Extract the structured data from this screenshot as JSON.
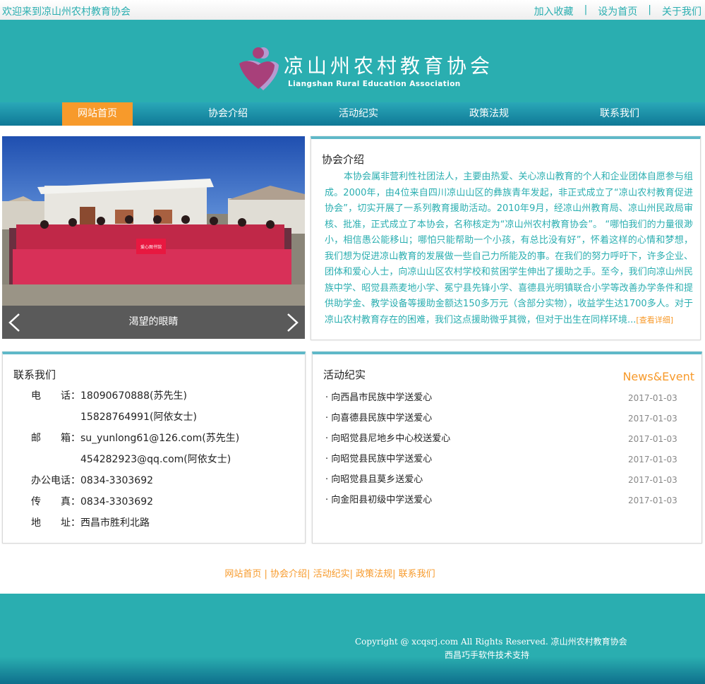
{
  "topbar": {
    "welcome": "欢迎来到凉山州农村教育协会",
    "links": [
      "加入收藏",
      "设为首页",
      "关于我们"
    ],
    "separator": "|"
  },
  "header": {
    "title_cn": "凉山州农村教育协会",
    "title_en": "Liangshan Rural Education Association"
  },
  "nav": {
    "items": [
      "网站首页",
      "协会介绍",
      "活动纪实",
      "政策法规",
      "联系我们"
    ],
    "active_index": 0
  },
  "slider": {
    "caption": "渴望的眼睛",
    "banner_text": "爱心图书馆"
  },
  "about": {
    "title": "协会介绍",
    "text": "本协会属非营利性社团法人，主要由热爱、关心凉山教育的个人和企业团体自愿参与组成。2000年，由4位来自四川凉山山区的彝族青年发起，非正式成立了“凉山农村教育促进协会”，切实开展了一系列教育援助活动。2010年9月，经凉山州教育局、凉山州民政局审核、批准，正式成立了本协会，名称核定为“凉山州农村教育协会”。 “哪怕我们的力量很渺小，相信愚公能移山；哪怕只能帮助一个小孩，有总比没有好”，怀着这样的心情和梦想，我们想为促进凉山教育的发展做一些自己力所能及的事。在我们的努力呼吁下，许多企业、团体和爱心人士，向凉山山区农村学校和贫困学生伸出了援助之手。至今，我们向凉山州民族中学、昭觉县燕麦地小学、冕宁县先锋小学、喜德县光明镇联合小学等改善办学条件和提供助学金、教学设备等援助金额达150多万元（含部分实物），收益学生达1700多人。对于凉山农村教育存在的困难，我们这点援助微乎其微，但对于出生在同样环境...",
    "more": "[查看详细]"
  },
  "contact": {
    "title": "联系我们",
    "rows": [
      {
        "label": "电　　话：",
        "value": "18090670888(苏先生)"
      },
      {
        "label": "",
        "value": "15828764991(阿依女士)"
      },
      {
        "label": "邮　　箱：",
        "value": "su_yunlong61@126.com(苏先生)"
      },
      {
        "label": "",
        "value": "454282923@qq.com(阿依女士)"
      },
      {
        "label": "办公电话：",
        "value": "0834-3303692"
      },
      {
        "label": "传　　真：",
        "value": "0834-3303692"
      },
      {
        "label": "地　　址：",
        "value": "西昌市胜利北路"
      }
    ]
  },
  "events": {
    "title": "活动纪实",
    "title_en": "News&Event",
    "items": [
      {
        "title": "· 向西昌市民族中学送爱心",
        "date": "2017-01-03"
      },
      {
        "title": "· 向喜德县民族中学送爱心",
        "date": "2017-01-03"
      },
      {
        "title": "· 向昭觉县尼地乡中心校送爱心",
        "date": "2017-01-03"
      },
      {
        "title": "· 向昭觉县民族中学送爱心",
        "date": "2017-01-03"
      },
      {
        "title": "· 向昭觉县且莫乡送爱心",
        "date": "2017-01-03"
      },
      {
        "title": "· 向金阳县初级中学送爱心",
        "date": "2017-01-03"
      }
    ]
  },
  "footer": {
    "nav": [
      "网站首页",
      "协会介绍",
      "活动纪实",
      "政策法规",
      "联系我们"
    ],
    "separators": [
      " | ",
      "| ",
      "| ",
      "| "
    ],
    "copyright": "Copyright @ xcqsrj.com All Rights Reserved. 凉山州农村教育协会",
    "support": "西昌巧手软件技术支持"
  },
  "colors": {
    "teal": "#2aaeb0",
    "nav_dark": "#0f7896",
    "accent_orange": "#f79a2b",
    "logo_pink": "#a8407a",
    "logo_lilac": "#b59ad0"
  }
}
